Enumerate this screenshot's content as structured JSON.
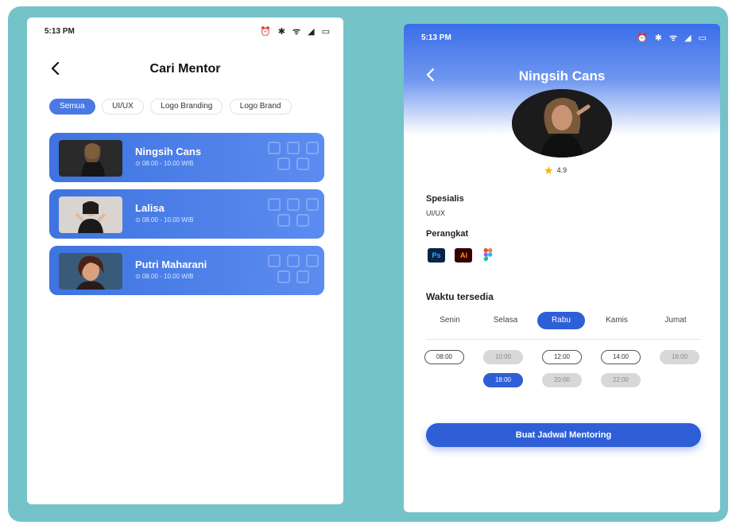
{
  "screen1": {
    "status": {
      "time": "5:13 PM",
      "icons_text": "⏰ ✱ ᯤ ◢ ▭"
    },
    "title": "Cari Mentor",
    "chips": [
      "Semua",
      "UI/UX",
      "Logo Branding",
      "Logo Brand"
    ],
    "active_chip": 0,
    "mentors": [
      {
        "name": "Ningsih Cans",
        "time": "⊙ 08.00 - 10.00 WIB"
      },
      {
        "name": "Lalisa",
        "time": "⊙ 08.00 - 10.00 WIB"
      },
      {
        "name": "Putri Maharani",
        "time": "⊙ 08.00 - 10.00 WIB"
      }
    ]
  },
  "screen2": {
    "status": {
      "time": "5:13 PM",
      "icons_text": "⏰ ✱ ᯤ ◢ ▭"
    },
    "title": "Ningsih Cans",
    "rating": "4.9",
    "spesialis_label": "Spesialis",
    "spesialis_value": "UI/UX",
    "perangkat_label": "Perangkat",
    "tools": [
      "Ps",
      "Ai",
      "figma-icon"
    ],
    "waktu_label": "Waktu tersedia",
    "days": [
      "Senin",
      "Selasa",
      "Rabu",
      "Kamis",
      "Jumat"
    ],
    "active_day": 2,
    "slots": [
      {
        "time": "08:00",
        "state": "avail"
      },
      {
        "time": "10:00",
        "state": "taken"
      },
      {
        "time": "12:00",
        "state": "avail"
      },
      {
        "time": "14:00",
        "state": "avail"
      },
      {
        "time": "16:00",
        "state": "taken"
      },
      {
        "time": "18:00",
        "state": "selected"
      },
      {
        "time": "20:00",
        "state": "taken"
      },
      {
        "time": "22:00",
        "state": "taken"
      }
    ],
    "cta_label": "Buat Jadwal Mentoring"
  },
  "colors": {
    "background": "#74c3c9",
    "primary": "#2e5fd7",
    "card": "#4a79e4",
    "star": "#f4b400"
  }
}
